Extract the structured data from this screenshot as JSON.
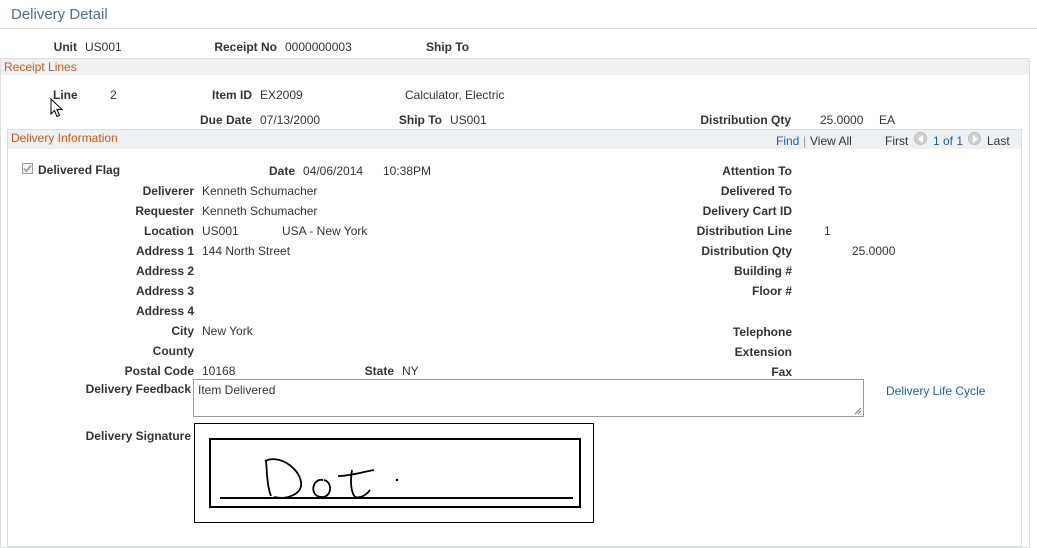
{
  "page": {
    "title": "Delivery Detail"
  },
  "header": {
    "unit_label": "Unit",
    "unit_value": "US001",
    "receipt_label": "Receipt No",
    "receipt_value": "0000000003",
    "shipto_label": "Ship To",
    "shipto_value": ""
  },
  "receipt_lines": {
    "title": "Receipt Lines",
    "line_label": "Line",
    "line_value": "2",
    "item_label": "Item ID",
    "item_value": "EX2009",
    "item_desc": "Calculator, Electric",
    "due_label": "Due Date",
    "due_value": "07/13/2000",
    "shipto_label": "Ship To",
    "shipto_value": "US001",
    "dist_qty_label": "Distribution Qty",
    "dist_qty_value": "25.0000",
    "uom": "EA"
  },
  "delivery": {
    "title": "Delivery Information",
    "nav": {
      "find": "Find",
      "sep": "|",
      "view_all": "View All",
      "first": "First",
      "count": "1 of 1",
      "last": "Last"
    },
    "delivered_flag_label": "Delivered Flag",
    "delivered_flag_checked": true,
    "date_label": "Date",
    "date_value": "04/06/2014",
    "time_value": "10:38PM",
    "deliverer_label": "Deliverer",
    "deliverer_value": "Kenneth Schumacher",
    "requester_label": "Requester",
    "requester_value": "Kenneth Schumacher",
    "location_label": "Location",
    "location_value": "US001",
    "location_desc": "USA - New York",
    "address1_label": "Address 1",
    "address1_value": "144 North Street",
    "address2_label": "Address 2",
    "address3_label": "Address 3",
    "address4_label": "Address 4",
    "city_label": "City",
    "city_value": "New York",
    "county_label": "County",
    "postal_label": "Postal Code",
    "postal_value": "10168",
    "state_label": "State",
    "state_value": "NY",
    "attention_label": "Attention To",
    "delivered_to_label": "Delivered To",
    "cart_label": "Delivery Cart ID",
    "dist_line_label": "Distribution Line",
    "dist_line_value": "1",
    "dist_qty_label": "Distribution Qty",
    "dist_qty_value": "25.0000",
    "building_label": "Building #",
    "floor_label": "Floor #",
    "telephone_label": "Telephone",
    "extension_label": "Extension",
    "fax_label": "Fax",
    "feedback_label": "Delivery Feedback",
    "feedback_value": "Item Delivered",
    "lifecycle_link": "Delivery Life Cycle",
    "signature_label": "Delivery Signature"
  },
  "colors": {
    "link": "#1f5d9e",
    "section_title": "#c65c17",
    "page_title": "#4a6f95",
    "section_bg": "#edf1f4"
  }
}
